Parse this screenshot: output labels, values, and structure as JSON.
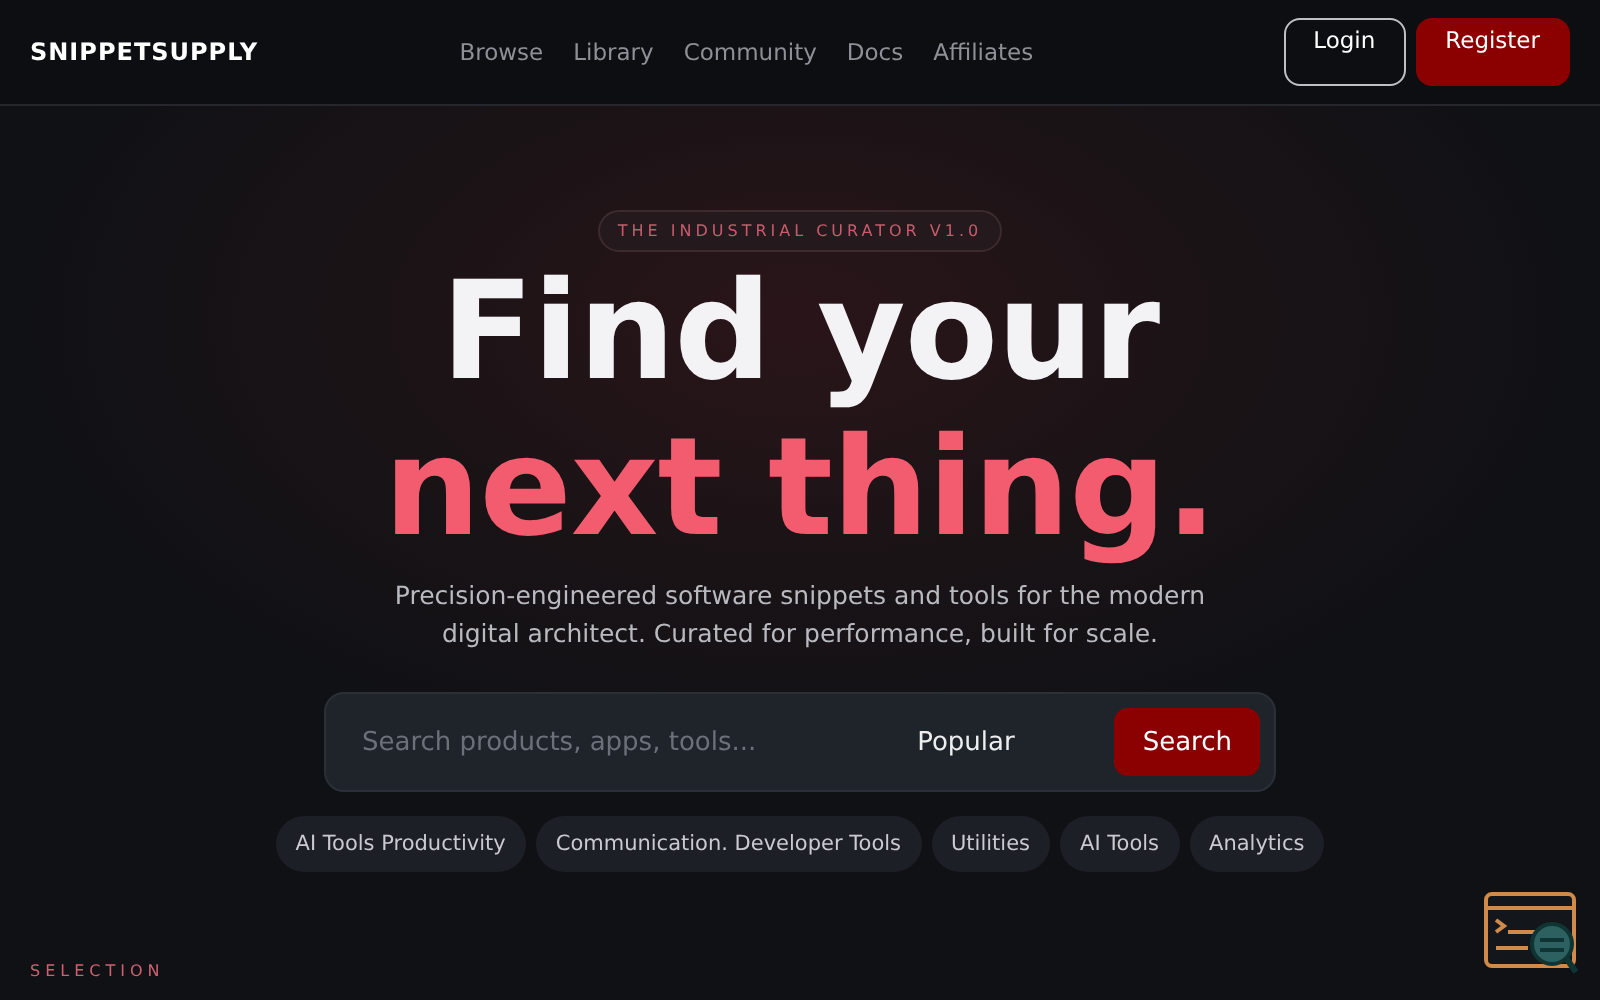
{
  "header": {
    "logo": "SNIPPETSUPPLY",
    "nav": [
      "Browse",
      "Library",
      "Community",
      "Docs",
      "Affiliates"
    ],
    "login": "Login",
    "register": "Register"
  },
  "hero": {
    "badge": "THE INDUSTRIAL CURATOR V1.0",
    "headline_line_1": "Find your",
    "headline_line_2": "next thing.",
    "subtitle": "Precision-engineered software snippets and tools for the modern digital architect. Curated for performance, built for scale.",
    "search": {
      "placeholder": "Search products, apps, tools...",
      "sort": "Popular",
      "button": "Search"
    },
    "tags": [
      "AI Tools Productivity",
      "Communication. Developer Tools",
      "Utilities",
      "AI Tools",
      "Analytics"
    ]
  },
  "section_label": "SELECTION"
}
